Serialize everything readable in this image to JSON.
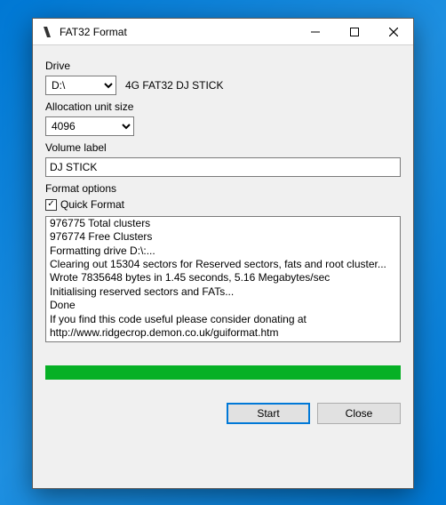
{
  "window": {
    "title": "FAT32 Format"
  },
  "labels": {
    "drive": "Drive",
    "allocation": "Allocation unit size",
    "volume": "Volume label",
    "format_options": "Format options",
    "quick_format": "Quick Format"
  },
  "drive": {
    "selected": "D:\\",
    "description": "4G FAT32 DJ STICK"
  },
  "allocation": {
    "selected": "4096"
  },
  "volume": {
    "value": "DJ STICK"
  },
  "checkbox": {
    "quick_format_checked": true,
    "check_glyph": "✓"
  },
  "log": {
    "lines": [
      "976775 Total clusters",
      "976774 Free Clusters",
      "Formatting drive D:\\:...",
      "Clearing out 15304 sectors for Reserved sectors, fats and root cluster...",
      "Wrote 7835648 bytes in 1.45 seconds, 5.16 Megabytes/sec",
      "Initialising reserved sectors and FATs...",
      "Done",
      "If you find this code useful please consider donating at",
      "http://www.ridgecrop.demon.co.uk/guiformat.htm"
    ]
  },
  "progress": {
    "percent": 100,
    "color": "#06b025"
  },
  "buttons": {
    "start": "Start",
    "close": "Close"
  }
}
